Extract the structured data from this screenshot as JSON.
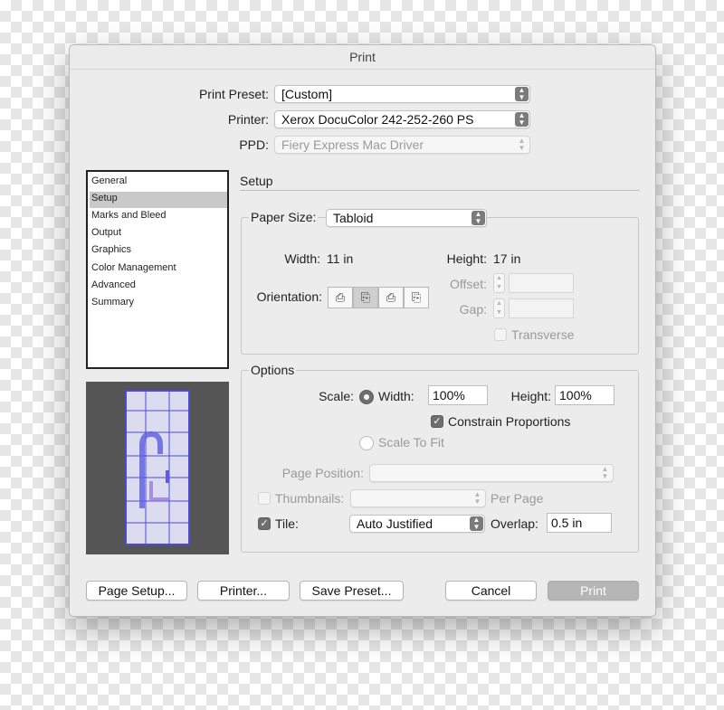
{
  "window": {
    "title": "Print"
  },
  "top": {
    "preset_label": "Print Preset:",
    "preset_value": "[Custom]",
    "printer_label": "Printer:",
    "printer_value": "Xerox DocuColor 242-252-260 PS",
    "ppd_label": "PPD:",
    "ppd_value": "Fiery Express Mac Driver"
  },
  "sidebar": {
    "items": [
      {
        "label": "General"
      },
      {
        "label": "Setup"
      },
      {
        "label": "Marks and Bleed"
      },
      {
        "label": "Output"
      },
      {
        "label": "Graphics"
      },
      {
        "label": "Color Management"
      },
      {
        "label": "Advanced"
      },
      {
        "label": "Summary"
      }
    ],
    "selected_index": 1
  },
  "setup": {
    "title": "Setup",
    "paper_size_label": "Paper Size:",
    "paper_size_value": "Tabloid",
    "width_label": "Width:",
    "width_value": "11 in",
    "height_label": "Height:",
    "height_value": "17 in",
    "orientation_label": "Orientation:",
    "orientation_icons": [
      "portrait-icon",
      "landscape-icon",
      "reverse-portrait-icon",
      "reverse-landscape-icon"
    ],
    "orientation_selected_index": 1,
    "offset_label": "Offset:",
    "gap_label": "Gap:",
    "transverse_label": "Transverse"
  },
  "options": {
    "title": "Options",
    "scale_label": "Scale:",
    "width_label": "Width:",
    "width_value": "100%",
    "height_label": "Height:",
    "height_value": "100%",
    "constrain_label": "Constrain Proportions",
    "constrain_checked": true,
    "scale_to_fit_label": "Scale To Fit",
    "page_position_label": "Page Position:",
    "thumbnails_label": "Thumbnails:",
    "per_page_label": "Per Page",
    "tile_label": "Tile:",
    "tile_checked": true,
    "tile_value": "Auto Justified",
    "overlap_label": "Overlap:",
    "overlap_value": "0.5 in"
  },
  "buttons": {
    "page_setup": "Page Setup...",
    "printer": "Printer...",
    "save_preset": "Save Preset...",
    "cancel": "Cancel",
    "print": "Print"
  },
  "colors": {
    "dialog_bg": "#ececec",
    "preview_bg": "#555555",
    "preview_page": "#dcdcf0",
    "preview_grid": "#4b4bd6",
    "selected_item": "#c9c9c9"
  }
}
